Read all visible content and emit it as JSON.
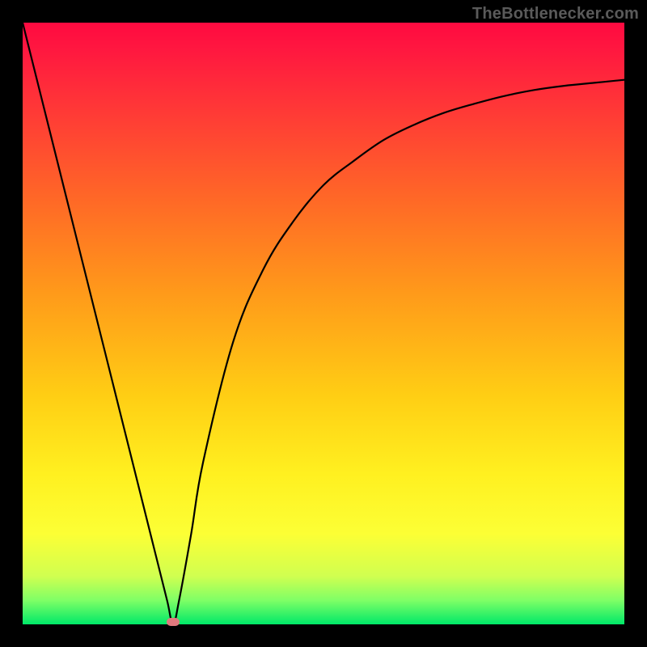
{
  "attribution": "TheBottlenecker.com",
  "chart_data": {
    "type": "line",
    "title": "",
    "xlabel": "",
    "ylabel": "",
    "xlim": [
      0,
      100
    ],
    "ylim": [
      0,
      100
    ],
    "x": [
      0,
      5,
      10,
      15,
      20,
      22,
      24,
      25,
      26,
      28,
      30,
      35,
      40,
      45,
      50,
      55,
      60,
      65,
      70,
      75,
      80,
      85,
      90,
      95,
      100
    ],
    "values": [
      100,
      80,
      60,
      40,
      20,
      12,
      4,
      0,
      4,
      15,
      27,
      47,
      59,
      67,
      73,
      77,
      80.5,
      83,
      85,
      86.5,
      87.8,
      88.8,
      89.5,
      90,
      90.5
    ],
    "marker": {
      "x": 25,
      "y": 0
    },
    "background_gradient": {
      "top": "#ff0a40",
      "mid": "#ffd520",
      "bottom": "#00e868"
    }
  }
}
